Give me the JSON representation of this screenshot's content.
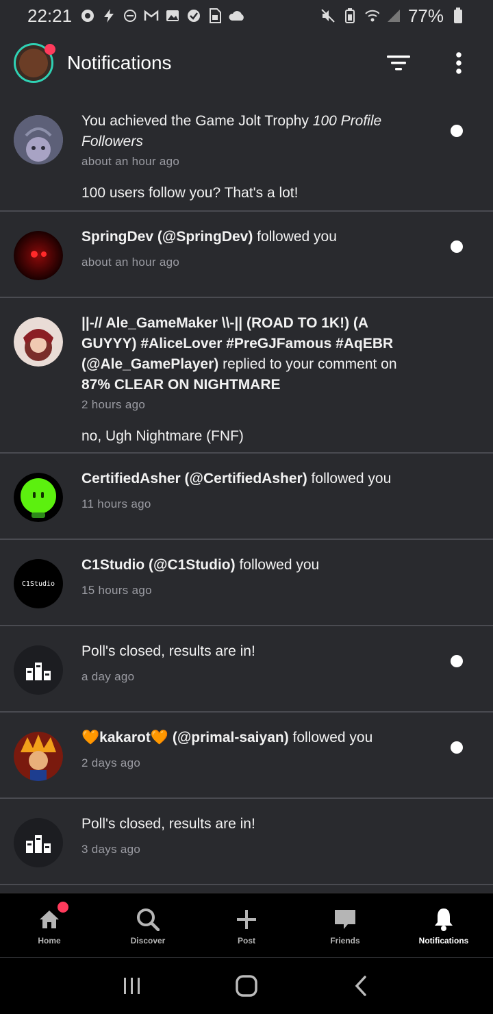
{
  "status": {
    "time": "22:21",
    "battery": "77%"
  },
  "header": {
    "title": "Notifications"
  },
  "notifications": [
    {
      "pre": "You achieved the Game Jolt Trophy ",
      "name": "100 Profile Followers",
      "post": "",
      "time": "about an hour ago",
      "message": "100 users follow you? That's a lot!",
      "unread": true
    },
    {
      "name": "SpringDev (@SpringDev)",
      "post": " followed you",
      "time": "about an hour ago",
      "unread": true
    },
    {
      "name": "||-// Ale_GameMaker \\\\-|| (ROAD TO 1K!) (A GUYYY) #AliceLover #PreGJFamous #AqEBR (@Ale_GamePlayer)",
      "post": " replied to your comment on ",
      "target": "87% CLEAR ON NIGHTMARE",
      "time": "2 hours ago",
      "message": "no, Ugh Nightmare (FNF)",
      "unread": false
    },
    {
      "name": "CertifiedAsher (@CertifiedAsher)",
      "post": " followed you",
      "time": "11 hours ago",
      "unread": false
    },
    {
      "avatar_text": "C1Studio",
      "name": "C1Studio (@C1Studio)",
      "post": " followed you",
      "time": "15 hours ago",
      "unread": false
    },
    {
      "pre": "Poll's closed, results are in!",
      "time": "a day ago",
      "unread": true
    },
    {
      "name": "🧡kakarot🧡 (@primal-saiyan)",
      "post": " followed you",
      "time": "2 days ago",
      "unread": true
    },
    {
      "pre": "Poll's closed, results are in!",
      "time": "3 days ago",
      "unread": false
    }
  ],
  "nav": {
    "home": "Home",
    "discover": "Discover",
    "post": "Post",
    "friends": "Friends",
    "notifications": "Notifications"
  },
  "colors": {
    "accent": "#2fd1b4",
    "badge": "#ff3b5c",
    "background": "#292a2e"
  }
}
